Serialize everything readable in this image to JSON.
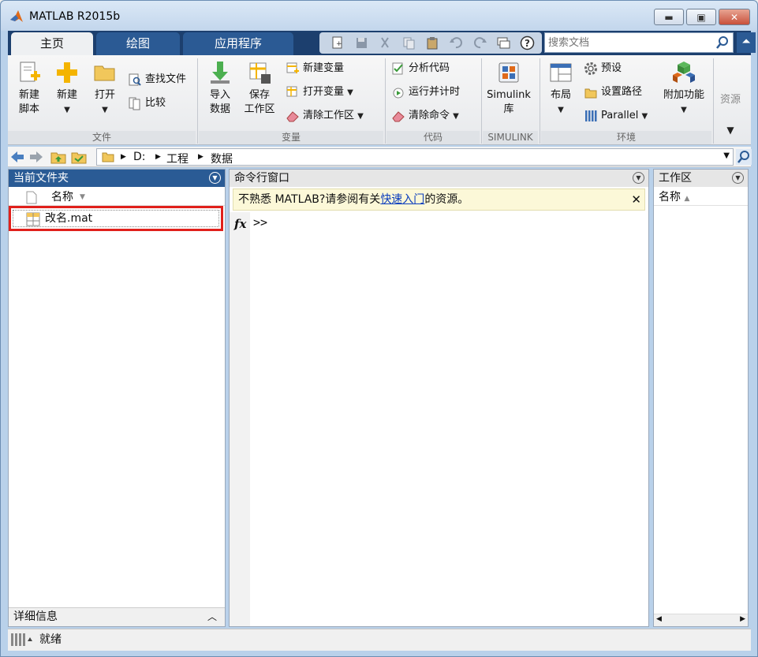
{
  "window": {
    "title": "MATLAB R2015b"
  },
  "tabs": [
    {
      "label": "主页"
    },
    {
      "label": "绘图"
    },
    {
      "label": "应用程序"
    }
  ],
  "search": {
    "placeholder": "搜索文档"
  },
  "ribbon": {
    "file": {
      "group_label": "文件",
      "new_script": "新建\n脚本",
      "new": "新建",
      "open": "打开",
      "find_files": "查找文件",
      "compare": "比较"
    },
    "variable": {
      "group_label": "变量",
      "import": "导入\n数据",
      "save_ws": "保存\n工作区",
      "new_var": "新建变量",
      "open_var": "打开变量",
      "clear_ws": "清除工作区"
    },
    "code": {
      "group_label": "代码",
      "analyze": "分析代码",
      "run_time": "运行并计时",
      "clear_cmd": "清除命令"
    },
    "simulink": {
      "group_label": "SIMULINK",
      "lib": "Simulink\n库"
    },
    "env": {
      "group_label": "环境",
      "layout": "布局",
      "prefs": "预设",
      "set_path": "设置路径",
      "parallel": "Parallel",
      "addons": "附加功能"
    },
    "resources": {
      "label": "资源"
    }
  },
  "address": {
    "crumbs": [
      "D:",
      "工程",
      "数据"
    ]
  },
  "current_folder": {
    "title": "当前文件夹",
    "col_name": "名称",
    "files": [
      {
        "name": "改名.mat"
      }
    ],
    "details": "详细信息"
  },
  "command_window": {
    "title": "命令行窗口",
    "notice_before": "不熟悉 MATLAB?请参阅有关",
    "notice_link": "快速入门",
    "notice_after": "的资源。",
    "prompt": ">>",
    "fx": "fx"
  },
  "workspace": {
    "title": "工作区",
    "col_name": "名称"
  },
  "status": {
    "text": "就绪"
  },
  "colors": {
    "tab_bar": "#1c3f6e",
    "tab_inactive": "#2b5a94",
    "panel_head_active": "#2a5b95",
    "highlight_box": "#e0201b"
  }
}
